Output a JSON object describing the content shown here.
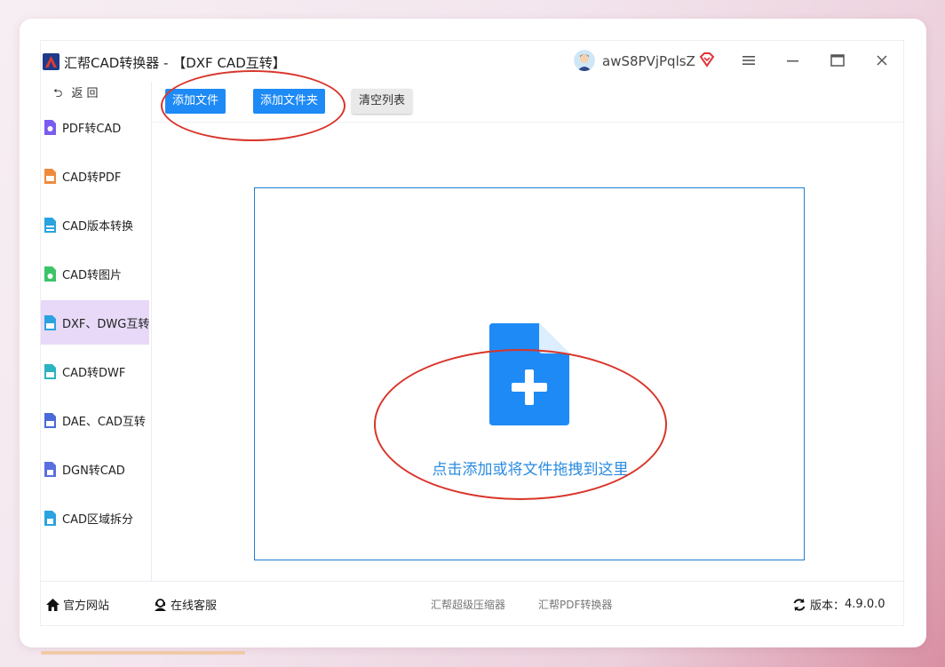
{
  "window": {
    "title": "汇帮CAD转换器 - 【DXF CAD互转】",
    "username": "awS8PVjPqlsZ",
    "controls": [
      "menu-icon",
      "minimize-icon",
      "maximize-icon",
      "close-icon"
    ]
  },
  "sidebar": {
    "back_label": "返 回",
    "items": [
      {
        "label": "PDF转CAD",
        "icon": "pdf-to-cad-icon",
        "color": "#7a5cf0"
      },
      {
        "label": "CAD转PDF",
        "icon": "cad-to-pdf-icon",
        "color": "#f08a3c"
      },
      {
        "label": "CAD版本转换",
        "icon": "cad-version-icon",
        "color": "#2aa3e0"
      },
      {
        "label": "CAD转图片",
        "icon": "cad-to-image-icon",
        "color": "#3cc46a"
      },
      {
        "label": "DXF、DWG互转",
        "icon": "dxf-dwg-icon",
        "color": "#2aa3e0",
        "active": true
      },
      {
        "label": "CAD转DWF",
        "icon": "cad-to-dwf-icon",
        "color": "#2ab3c0"
      },
      {
        "label": "DAE、CAD互转",
        "icon": "dae-cad-icon",
        "color": "#4a6ad8"
      },
      {
        "label": "DGN转CAD",
        "icon": "dgn-to-cad-icon",
        "color": "#5a6ee0"
      },
      {
        "label": "CAD区域拆分",
        "icon": "cad-split-icon",
        "color": "#2aa3e0"
      }
    ]
  },
  "toolbar": {
    "add_file": "添加文件",
    "add_folder": "添加文件夹",
    "clear_list": "清空列表"
  },
  "dropzone": {
    "text": "点击添加或将文件拖拽到这里",
    "accent": "#1e8af5"
  },
  "footer": {
    "website": "官方网站",
    "support": "在线客服",
    "link_compressor": "汇帮超级压缩器",
    "link_pdf": "汇帮PDF转换器",
    "version_label": "版本：",
    "version": "4.9.0.0"
  }
}
